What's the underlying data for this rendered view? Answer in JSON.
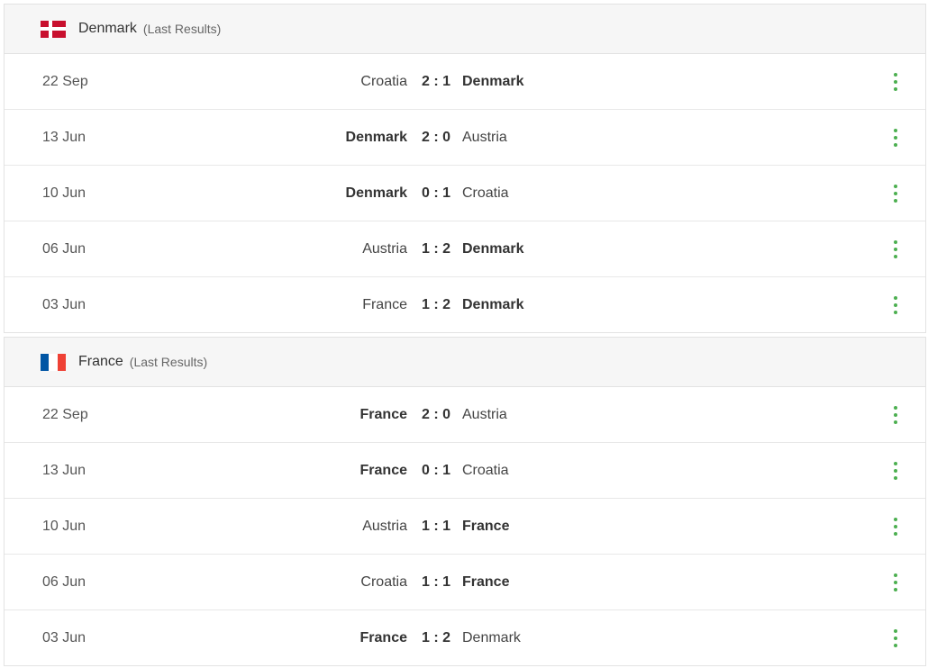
{
  "accent_color": "#4caf50",
  "sections": [
    {
      "team": "Denmark",
      "note": "(Last Results)",
      "flag": "denmark-flag",
      "flag_colors": [
        "#c8102e",
        "#ffffff"
      ],
      "matches": [
        {
          "date": "22 Sep",
          "home": "Croatia",
          "home_bold": false,
          "score": "2 : 1",
          "away": "Denmark",
          "away_bold": true
        },
        {
          "date": "13 Jun",
          "home": "Denmark",
          "home_bold": true,
          "score": "2 : 0",
          "away": "Austria",
          "away_bold": false
        },
        {
          "date": "10 Jun",
          "home": "Denmark",
          "home_bold": true,
          "score": "0 : 1",
          "away": "Croatia",
          "away_bold": false
        },
        {
          "date": "06 Jun",
          "home": "Austria",
          "home_bold": false,
          "score": "1 : 2",
          "away": "Denmark",
          "away_bold": true
        },
        {
          "date": "03 Jun",
          "home": "France",
          "home_bold": false,
          "score": "1 : 2",
          "away": "Denmark",
          "away_bold": true
        }
      ]
    },
    {
      "team": "France",
      "note": "(Last Results)",
      "flag": "france-flag",
      "flag_colors": [
        "#0055a4",
        "#ffffff",
        "#ef4135"
      ],
      "matches": [
        {
          "date": "22 Sep",
          "home": "France",
          "home_bold": true,
          "score": "2 : 0",
          "away": "Austria",
          "away_bold": false
        },
        {
          "date": "13 Jun",
          "home": "France",
          "home_bold": true,
          "score": "0 : 1",
          "away": "Croatia",
          "away_bold": false
        },
        {
          "date": "10 Jun",
          "home": "Austria",
          "home_bold": false,
          "score": "1 : 1",
          "away": "France",
          "away_bold": true
        },
        {
          "date": "06 Jun",
          "home": "Croatia",
          "home_bold": false,
          "score": "1 : 1",
          "away": "France",
          "away_bold": true
        },
        {
          "date": "03 Jun",
          "home": "France",
          "home_bold": true,
          "score": "1 : 2",
          "away": "Denmark",
          "away_bold": false
        }
      ]
    }
  ]
}
